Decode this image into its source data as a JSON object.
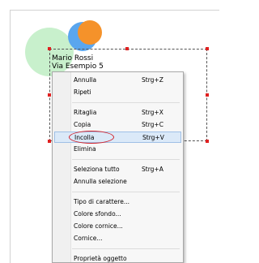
{
  "canvas": {
    "address_lines": [
      "Mario Rossi",
      "Via Esempio 5"
    ],
    "circle_colors": {
      "green": "#c8f0cc",
      "blue": "#5aa6ee",
      "orange": "#f5922a"
    },
    "handle_color": "#e02020"
  },
  "context_menu": {
    "groups": [
      [
        {
          "label": "Annulla",
          "shortcut": "Strg+Z"
        },
        {
          "label": "Ripeti",
          "shortcut": ""
        }
      ],
      [
        {
          "label": "Ritaglia",
          "shortcut": "Strg+X"
        },
        {
          "label": "Copia",
          "shortcut": "Strg+C"
        },
        {
          "label": "Incolla",
          "shortcut": "Strg+V",
          "highlighted": true
        },
        {
          "label": "Elimina",
          "shortcut": ""
        }
      ],
      [
        {
          "label": "Seleziona tutto",
          "shortcut": "Strg+A"
        },
        {
          "label": "Annulla selezione",
          "shortcut": ""
        }
      ],
      [
        {
          "label": "Tipo di carattere...",
          "shortcut": ""
        },
        {
          "label": "Colore sfondo...",
          "shortcut": ""
        },
        {
          "label": "Colore cornice...",
          "shortcut": ""
        },
        {
          "label": "Cornice...",
          "shortcut": ""
        }
      ],
      [
        {
          "label": "Proprietà oggetto",
          "shortcut": ""
        }
      ]
    ],
    "highlight_color": "#dbe9f8",
    "annotation_color": "#d2202a"
  }
}
